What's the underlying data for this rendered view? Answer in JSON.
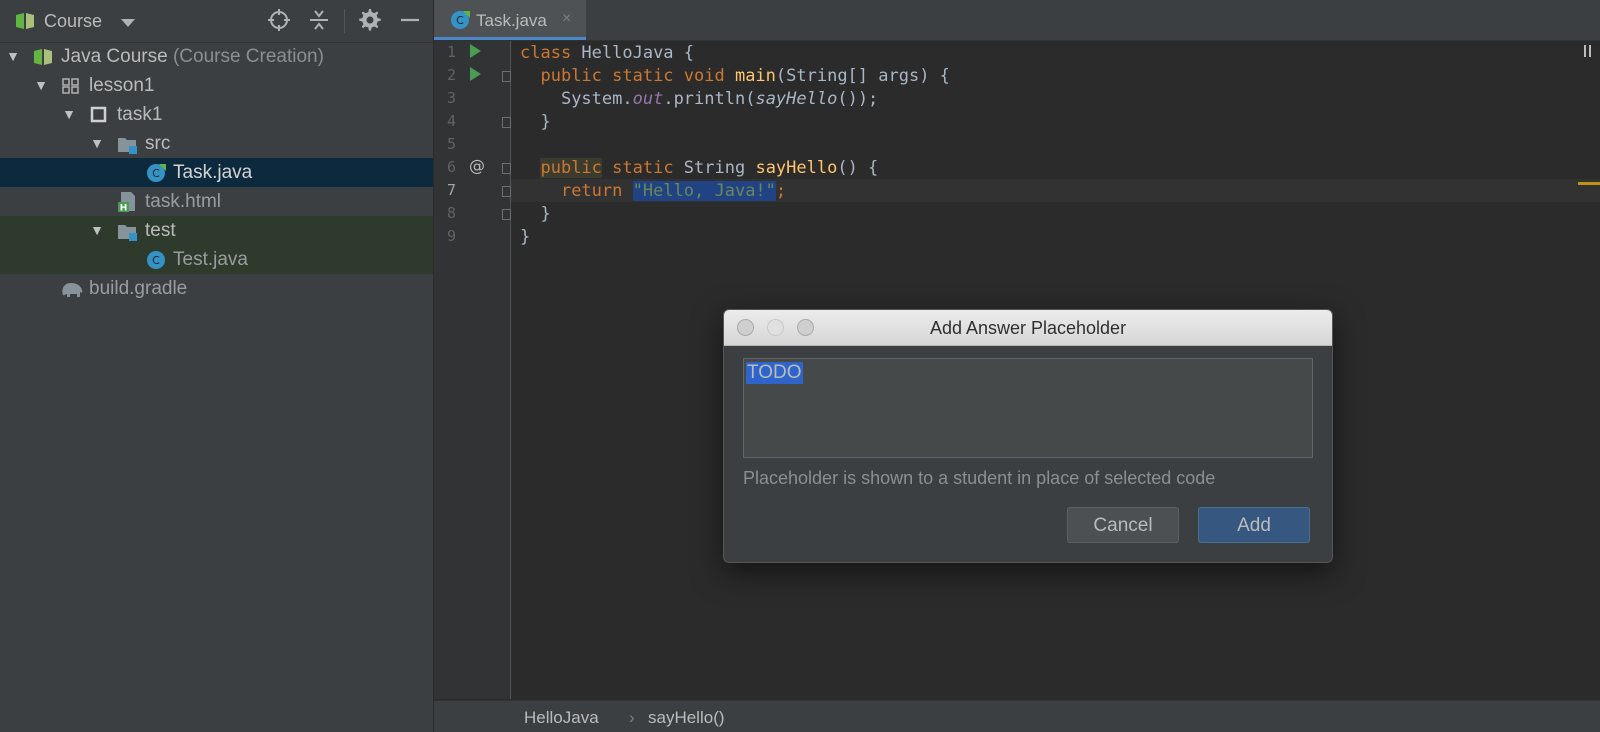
{
  "sidebar": {
    "title": "Course",
    "tree": [
      {
        "label": "Java Course",
        "note": "(Course Creation)"
      },
      {
        "label": "lesson1"
      },
      {
        "label": "task1"
      },
      {
        "label": "src"
      },
      {
        "label": "Task.java"
      },
      {
        "label": "task.html"
      },
      {
        "label": "test"
      },
      {
        "label": "Test.java"
      },
      {
        "label": "build.gradle"
      }
    ]
  },
  "editor": {
    "tab": {
      "label": "Task.java",
      "close": "×"
    },
    "line_numbers": [
      "1",
      "2",
      "3",
      "4",
      "5",
      "6",
      "7",
      "8",
      "9"
    ],
    "annotation": "@",
    "code": {
      "l1": {
        "t1": "class ",
        "t2": "HelloJava {"
      },
      "l2": {
        "t1": "public static void ",
        "t2": "main",
        "t3": "(String[] args) {"
      },
      "l3": {
        "t1": "System.",
        "t2": "out",
        "t3": ".println(",
        "t4": "sayHello",
        "t5": "());"
      },
      "l4": {
        "t1": "}"
      },
      "l6": {
        "t1": "public",
        "t2": " static ",
        "t3": "String ",
        "t4": "sayHello",
        "t5": "() {"
      },
      "l7": {
        "t1": "return ",
        "t2": "\"Hello, Java!\"",
        "t3": ";"
      },
      "l8": {
        "t1": "}"
      },
      "l9": {
        "t1": "}"
      }
    },
    "breadcrumbs": [
      "HelloJava",
      "›",
      "sayHello()"
    ]
  },
  "dialog": {
    "title": "Add Answer Placeholder",
    "text_value": "TODO",
    "hint": "Placeholder is shown to a student in place of selected code",
    "cancel_label": "Cancel",
    "add_label": "Add"
  },
  "colors": {
    "selection": "#0d293e",
    "test_bg": "#2e3b2c",
    "accent": "#4a88c7",
    "add_button": "#365880"
  }
}
